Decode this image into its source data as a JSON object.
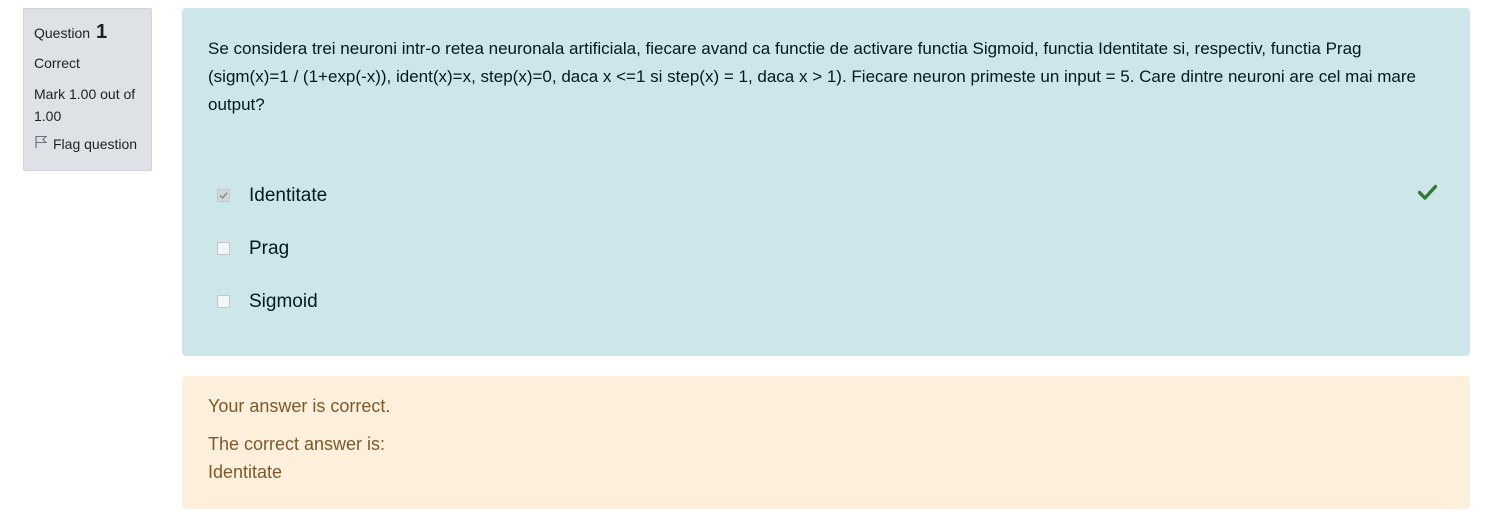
{
  "info": {
    "question_label": "Question",
    "question_number": "1",
    "state": "Correct",
    "grade": "Mark 1.00 out of 1.00",
    "flag_label": "Flag question"
  },
  "question": {
    "text": "Se considera trei neuroni intr-o retea neuronala artificiala, fiecare avand ca functie de activare functia Sigmoid, functia Identitate si, respectiv, functia Prag (sigm(x)=1 / (1+exp(-x)), ident(x)=x, step(x)=0, daca x <=1 si step(x) = 1, daca x > 1). Fiecare neuron primeste un input = 5. Care dintre neuroni are cel mai mare output?",
    "answers": [
      {
        "label": "Identitate",
        "checked": true,
        "correct": true
      },
      {
        "label": "Prag",
        "checked": false,
        "correct": false
      },
      {
        "label": "Sigmoid",
        "checked": false,
        "correct": false
      }
    ]
  },
  "outcome": {
    "feedback": "Your answer is correct.",
    "right_answer_intro": "The correct answer is:",
    "right_answer": "Identitate"
  },
  "colors": {
    "formulation_bg": "#cce6ea",
    "outcome_bg": "#fcefdc",
    "info_bg": "#dee2e6",
    "correct_green": "#357a32"
  },
  "icons": {
    "flag": "flag-icon",
    "correct": "check-icon"
  }
}
